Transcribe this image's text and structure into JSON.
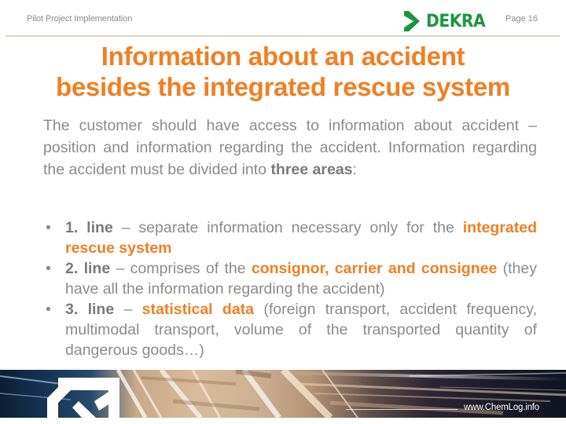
{
  "header": {
    "section_title": "Pilot Project Implementation",
    "logo_text": "DEKRA",
    "logo_icon": "dekra-arrow-icon",
    "page_label": "Page 16",
    "brand_color": "#1a9640"
  },
  "slide": {
    "title_line1": "Information about an accident",
    "title_line2": "besides the integrated rescue system",
    "accent_color": "#f07f23",
    "intro": {
      "text": "The customer should have access to information about accident – position and information regarding the accident. Information regarding the accident must be divided into ",
      "bold": "three areas",
      "end": ":"
    },
    "bullets": [
      {
        "label": "1. line",
        "text": " – separate information necessary only for the ",
        "highlight": "integrated rescue system",
        "after": ""
      },
      {
        "label": "2. line",
        "text": " – comprises of the ",
        "highlight": "consignor, carrier and consignee",
        "after": " (they have all the information regarding the accident)"
      },
      {
        "label": "3. line",
        "text": " – ",
        "highlight": "statistical data",
        "after": " (foreign transport, accident frequency, multimodal transport, volume of the transported quantity of dangerous goods…)"
      }
    ]
  },
  "footer": {
    "url": "www.ChemLog.info",
    "logo_icon": "chemlog-arrow-icon"
  }
}
